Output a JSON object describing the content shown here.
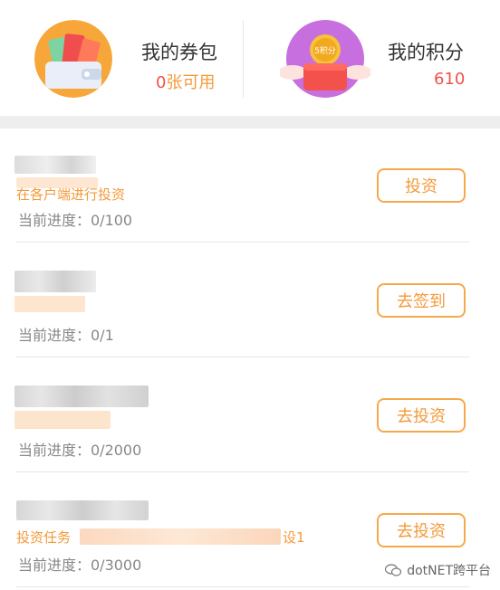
{
  "wallet": {
    "title": "我的券包",
    "count": "0",
    "suffix": "张可用",
    "icon": "wallet-coupon-icon"
  },
  "points": {
    "title": "我的积分",
    "value": "610",
    "icon": "points-gift-icon",
    "coin_text": "5积分"
  },
  "tasks": [
    {
      "name": "",
      "desc": "在各户端进行投资",
      "progress": "当前进度：0/100",
      "button": "投资"
    },
    {
      "name": "",
      "desc": "",
      "progress": "当前进度：0/1",
      "button": "去签到"
    },
    {
      "name": "",
      "desc": "",
      "progress": "当前进度：0/2000",
      "button": "去投资"
    },
    {
      "name": "",
      "desc": "投资任务",
      "desc_end": "设1",
      "progress": "当前进度：0/3000",
      "button": "去投资"
    }
  ],
  "watermark": {
    "text": "dotNET跨平台",
    "icon": "wechat-icon"
  },
  "colors": {
    "accent": "#f39a3a",
    "value_red": "#f0524a",
    "border": "#f6a94c"
  }
}
